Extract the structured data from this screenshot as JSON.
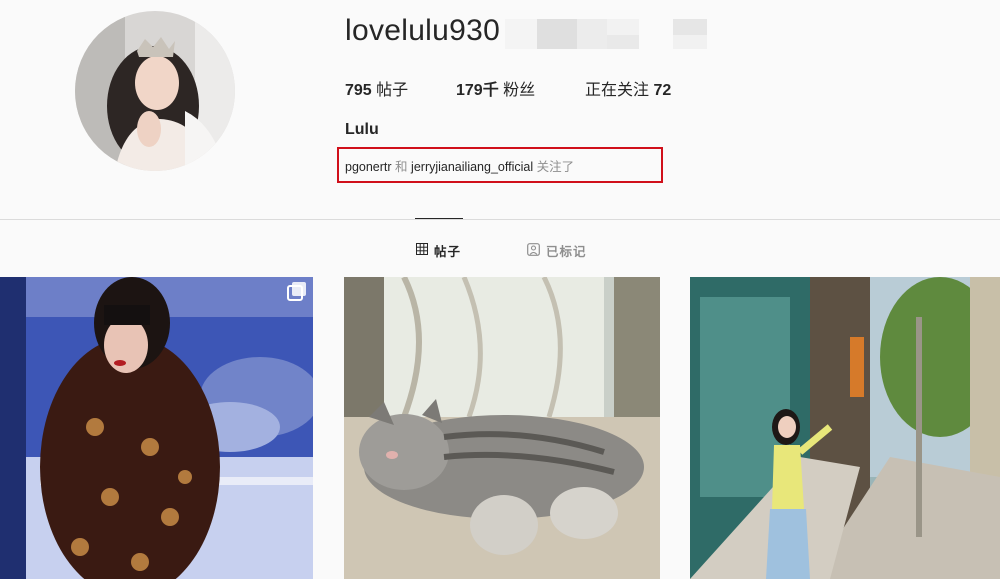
{
  "profile": {
    "username": "lovelulu930",
    "full_name": "Lulu",
    "stats": {
      "posts_count": "795",
      "posts_label": "帖子",
      "followers_count": "179千",
      "followers_label": "粉丝",
      "following_label": "正在关注",
      "following_count": "72"
    },
    "followed_by": {
      "user1": "pgonertr",
      "conjunction": "和",
      "user2": "jerryjianailiang_official",
      "suffix": "关注了"
    }
  },
  "tabs": [
    {
      "label": "帖子",
      "icon": "grid-icon",
      "active": true
    },
    {
      "label": "已标记",
      "icon": "tagged-icon",
      "active": false
    }
  ],
  "grid": {
    "posts": [
      {
        "subject": "woman in patterned hoodie by aquarium",
        "icon": "multi-post-icon"
      },
      {
        "subject": "tabby cat sleeping on rug by window"
      },
      {
        "subject": "girl in yellow top on street sidewalk"
      }
    ]
  },
  "colors": {
    "background": "#fafafa",
    "text": "#262626",
    "muted": "#8e8e8e",
    "divider": "#dbdbdb",
    "highlight": "#d0101a"
  }
}
